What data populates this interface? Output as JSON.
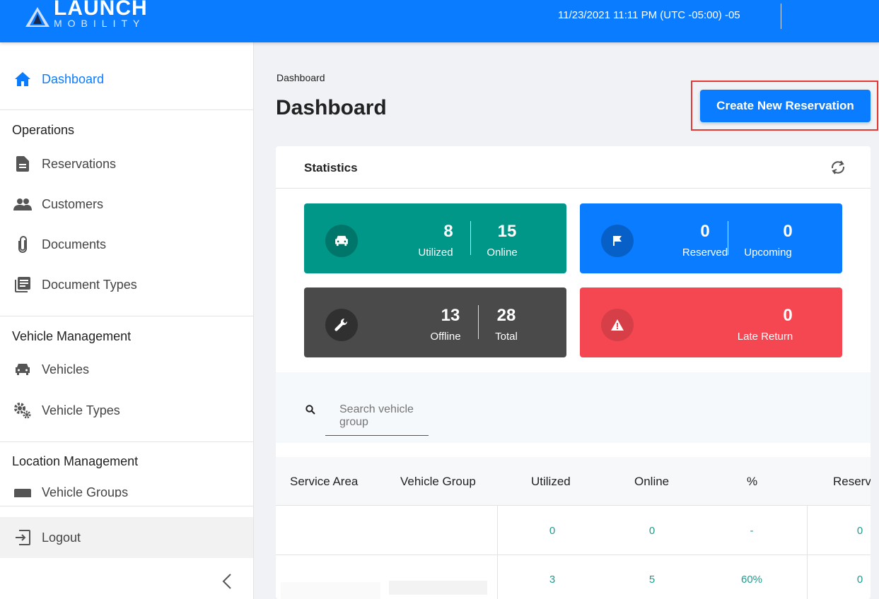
{
  "header": {
    "logo_main": "LAUNCH",
    "logo_sub": "MOBILITY",
    "datetime": "11/23/2021 11:11 PM (UTC -05:00) -05"
  },
  "sidebar": {
    "dashboard": "Dashboard",
    "sections": {
      "operations": "Operations",
      "vehicle_management": "Vehicle Management",
      "location_management": "Location Management"
    },
    "items": {
      "reservations": "Reservations",
      "customers": "Customers",
      "documents": "Documents",
      "document_types": "Document Types",
      "vehicles": "Vehicles",
      "vehicle_types": "Vehicle Types",
      "vehicle_groups": "Vehicle Groups"
    },
    "logout": "Logout"
  },
  "main": {
    "breadcrumb": "Dashboard",
    "title": "Dashboard",
    "create_button": "Create New Reservation"
  },
  "statistics": {
    "title": "Statistics",
    "tiles": {
      "utilized": {
        "value": "8",
        "label": "Utilized"
      },
      "online": {
        "value": "15",
        "label": "Online"
      },
      "reserved": {
        "value": "0",
        "label": "Reserved"
      },
      "upcoming": {
        "value": "0",
        "label": "Upcoming"
      },
      "offline": {
        "value": "13",
        "label": "Offline"
      },
      "total": {
        "value": "28",
        "label": "Total"
      },
      "late_return": {
        "value": "0",
        "label": "Late Return"
      }
    },
    "colors": {
      "teal": "#009688",
      "blue": "#0a7cff",
      "gray": "#4a4a4a",
      "red": "#f44752"
    }
  },
  "search": {
    "placeholder": "Search vehicle group"
  },
  "table": {
    "headers": {
      "service_area": "Service Area",
      "vehicle_group": "Vehicle Group",
      "utilized": "Utilized",
      "online": "Online",
      "percent": "%",
      "reserved": "Reserv"
    },
    "rows": [
      {
        "utilized": "0",
        "online": "0",
        "percent": "-",
        "reserved": "0"
      },
      {
        "utilized": "3",
        "online": "5",
        "percent": "60%",
        "reserved": "0"
      }
    ]
  }
}
